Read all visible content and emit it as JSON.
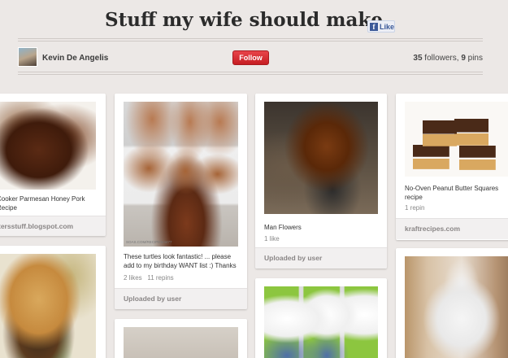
{
  "board": {
    "title": "Stuff my wife should make",
    "like_label": "Like",
    "like_icon": "facebook-icon"
  },
  "user": {
    "name": "Kevin De Angelis",
    "follow_label": "Follow",
    "followers_count": "35",
    "followers_label": " followers, ",
    "pins_count": "9",
    "pins_label": " pins"
  },
  "colors": {
    "follow_button": "#cb2027",
    "background": "#ece8e6"
  },
  "pins": [
    {
      "description_lines": [
        "Cooker Parmesan Honey Pork",
        "Recipe"
      ],
      "source": "tersstuff.blogspot.com"
    },
    {
      "image_caption": "SOAS.COM/RECIPES/4477",
      "description_lines": [
        "These turtles look fantastic! ... please",
        "add to my birthday WANT list :) Thanks"
      ],
      "likes": "2 likes",
      "repins": "11 repins",
      "footer": "Uploaded by user"
    },
    {
      "description_lines": [
        "Man Flowers"
      ],
      "likes": "1 like",
      "footer": "Uploaded by user"
    },
    {
      "description_lines": [
        "No-Oven Peanut Butter Squares",
        "recipe"
      ],
      "repins": "1 repin",
      "source": "kraftrecipes.com"
    }
  ]
}
